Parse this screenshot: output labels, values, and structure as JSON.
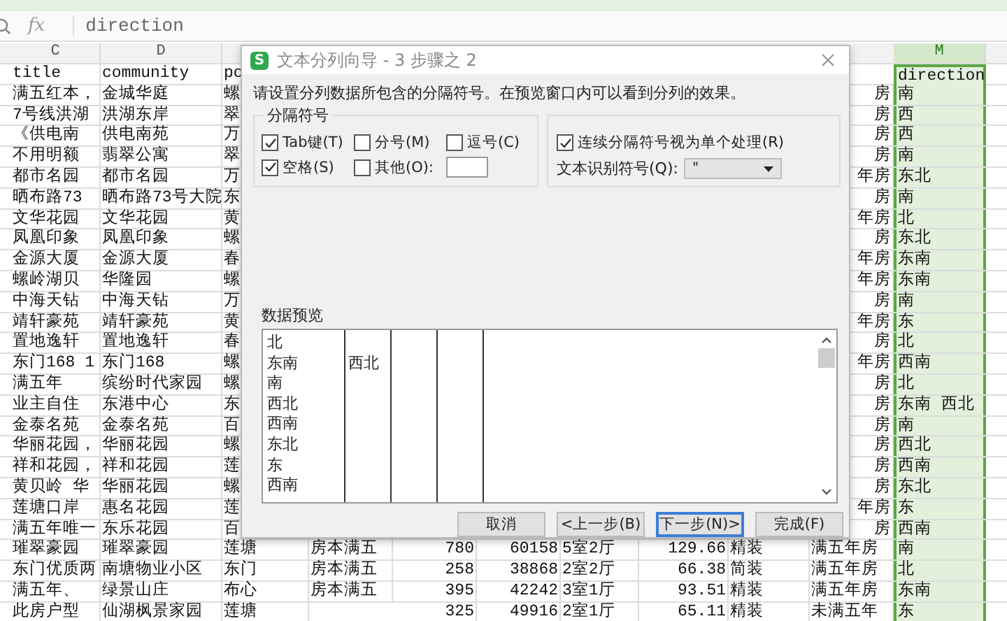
{
  "formula_bar": {
    "fx": "fx",
    "value": "direction"
  },
  "sheet": {
    "column_headers": [
      {
        "label": "C",
        "selected": false
      },
      {
        "label": "D",
        "selected": false
      },
      {
        "label": "M",
        "selected": true
      }
    ],
    "rows": [
      {
        "kind": "partial",
        "title": "title",
        "community": "community",
        "col_e": "po",
        "direction": "direction"
      },
      {
        "kind": "partial",
        "title": "满五红本，",
        "community": "金城华庭",
        "col_e": "螺",
        "col_l": "房",
        "direction": "南"
      },
      {
        "kind": "partial",
        "title": "7号线洪湖",
        "community": "洪湖东岸",
        "col_e": "翠",
        "col_l": "房",
        "direction": "西"
      },
      {
        "kind": "partial",
        "title": "《供电南",
        "community": "供电南苑",
        "col_e": "万",
        "col_l": "房",
        "direction": "西"
      },
      {
        "kind": "partial",
        "title": "不用明额",
        "community": "翡翠公寓",
        "col_e": "翠",
        "col_l": "房",
        "direction": "南"
      },
      {
        "kind": "partial",
        "title": "都市名园",
        "community": "都市名园",
        "col_e": "万",
        "col_l": "年房",
        "direction": "东北"
      },
      {
        "kind": "partial",
        "title": "晒布路73",
        "community": "晒布路73号大院",
        "col_e": "东",
        "col_l": "房",
        "direction": "南"
      },
      {
        "kind": "partial",
        "title": "文华花园",
        "community": "文华花园",
        "col_e": "黄",
        "col_l": "年房",
        "direction": "北"
      },
      {
        "kind": "partial",
        "title": "凤凰印象",
        "community": "凤凰印象",
        "col_e": "螺",
        "col_l": "房",
        "direction": "东北"
      },
      {
        "kind": "partial",
        "title": "金源大厦",
        "community": "金源大厦",
        "col_e": "春",
        "col_l": "年房",
        "direction": "东南"
      },
      {
        "kind": "partial",
        "title": "螺岭湖贝",
        "community": "华隆园",
        "col_e": "螺",
        "col_l": "年房",
        "direction": "东南"
      },
      {
        "kind": "partial",
        "title": "中海天钻",
        "community": "中海天钻",
        "col_e": "万",
        "col_l": "房",
        "direction": "南"
      },
      {
        "kind": "partial",
        "title": "靖轩豪苑",
        "community": "靖轩豪苑",
        "col_e": "黄",
        "col_l": "年房",
        "direction": "东"
      },
      {
        "kind": "partial",
        "title": "置地逸轩",
        "community": "置地逸轩",
        "col_e": "春",
        "col_l": "房",
        "direction": "北"
      },
      {
        "kind": "partial",
        "title": "东门168 1",
        "community": "东门168",
        "col_e": "螺",
        "col_l": "年房",
        "direction": "西南"
      },
      {
        "kind": "partial",
        "title": "满五年",
        "community": "缤纷时代家园",
        "col_e": "螺",
        "col_l": "房",
        "direction": "北"
      },
      {
        "kind": "partial",
        "title": "业主自住",
        "community": "东港中心",
        "col_e": "东",
        "col_l": "房",
        "direction": "东南 西北"
      },
      {
        "kind": "partial",
        "title": "金泰名苑",
        "community": "金泰名苑",
        "col_e": "百",
        "col_l": "房",
        "direction": "南"
      },
      {
        "kind": "partial",
        "title": "华丽花园，",
        "community": "华丽花园",
        "col_e": "螺",
        "col_l": "房",
        "direction": "西北"
      },
      {
        "kind": "partial",
        "title": "祥和花园，",
        "community": "祥和花园",
        "col_e": "莲",
        "col_l": "房",
        "direction": "西南"
      },
      {
        "kind": "partial",
        "title": "黄贝岭 华",
        "community": "华丽花园",
        "col_e": "螺",
        "col_l": "房",
        "direction": "东北"
      },
      {
        "kind": "partial",
        "title": "莲塘口岸",
        "community": "惠名花园",
        "col_e": "莲",
        "col_l": "年房",
        "direction": "东"
      },
      {
        "kind": "partial",
        "title": "满五年唯一",
        "community": "东乐花园",
        "col_e": "百",
        "col_l": "房",
        "direction": "西南"
      },
      {
        "kind": "full",
        "title": "璀翠豪园",
        "community": "璀翠豪园",
        "col_e": "莲塘",
        "col_f": "房本满五",
        "col_g": "780",
        "col_h": "60158",
        "col_i": "5室2厅",
        "col_j": "129.66",
        "col_k": "精装",
        "col_l": "满五年房",
        "direction": "南"
      },
      {
        "kind": "full",
        "title": "东门优质两",
        "community": "南塘物业小区",
        "col_e": "东门",
        "col_f": "房本满五",
        "col_g": "258",
        "col_h": "38868",
        "col_i": "2室2厅",
        "col_j": "66.38",
        "col_k": "简装",
        "col_l": "满五年房",
        "direction": "北"
      },
      {
        "kind": "full",
        "title": "满五年、",
        "community": "绿景山庄",
        "col_e": "布心",
        "col_f": "房本满五",
        "col_g": "395",
        "col_h": "42242",
        "col_i": "3室1厅",
        "col_j": "93.51",
        "col_k": "精装",
        "col_l": "满五年房",
        "direction": "东南"
      },
      {
        "kind": "full",
        "title": "此房户型",
        "community": "仙湖枫景家园",
        "col_e": "莲塘",
        "col_g": "325",
        "col_h": "49916",
        "col_i": "2室1厅",
        "col_j": "65.11",
        "col_k": "精装",
        "col_l": "未满五年",
        "direction": "东"
      }
    ]
  },
  "dialog": {
    "icon_text": "S",
    "title": "文本分列向导 - 3 步骤之 2",
    "instruction": "请设置分列数据所包含的分隔符号。在预览窗口内可以看到分列的效果。",
    "delimiters": {
      "label": "分隔符号",
      "options": [
        {
          "label": "Tab键(T)",
          "checked": true
        },
        {
          "label": "分号(M)",
          "checked": false
        },
        {
          "label": "逗号(C)",
          "checked": false
        },
        {
          "label": "空格(S)",
          "checked": true
        },
        {
          "label": "其他(O):",
          "checked": false
        }
      ]
    },
    "consecutive": {
      "label": "连续分隔符号视为单个处理(R)",
      "checked": true
    },
    "qualifier": {
      "label": "文本识别符号(Q):",
      "value": "\""
    },
    "preview": {
      "label": "数据预览",
      "rows": [
        {
          "cells": [
            "北"
          ]
        },
        {
          "cells": [
            "东南",
            "西北"
          ]
        },
        {
          "cells": [
            "南"
          ]
        },
        {
          "cells": [
            "西北"
          ]
        },
        {
          "cells": [
            "西南"
          ]
        },
        {
          "cells": [
            "东北"
          ]
        },
        {
          "cells": [
            "东"
          ]
        },
        {
          "cells": [
            "西南"
          ]
        }
      ]
    },
    "buttons": [
      {
        "label": "取消",
        "focused": false
      },
      {
        "label": "<上一步(B)",
        "focused": false
      },
      {
        "label": "下一步(N)>",
        "focused": true
      },
      {
        "label": "完成(F)",
        "focused": false
      }
    ]
  }
}
